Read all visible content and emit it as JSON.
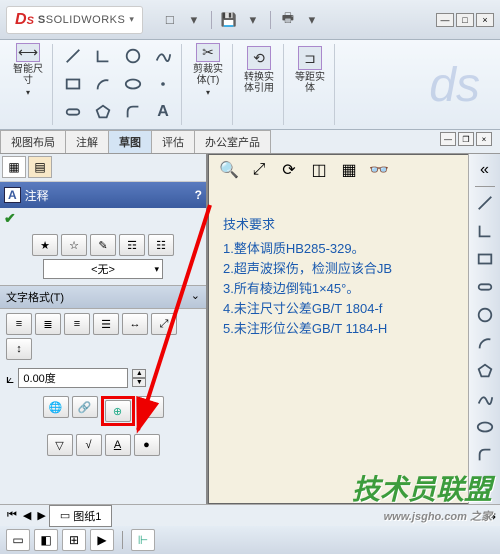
{
  "app": {
    "brand_prefix": "S",
    "brand": "SOLIDWORKS"
  },
  "ribbon": {
    "smart_dim": "智能尺\n寸",
    "trim": "剪裁实\n体(T)",
    "convert": "转换实\n体引用",
    "offset": "等距实\n体"
  },
  "tabs": [
    "视图布局",
    "注解",
    "草图",
    "评估",
    "办公室产品"
  ],
  "active_tab": 2,
  "panel": {
    "header_A": "A",
    "header_title": "注释",
    "header_help": "?",
    "style_combo": "<无>",
    "format_title": "文字格式(T)",
    "angle_value": "0.00度"
  },
  "notes_block": {
    "title": "技术要求",
    "lines": [
      "1.整体调质HB285-329。",
      "2.超声波探伤，检测应该合JB",
      "3.所有棱边倒钝1×45°。",
      "4.未注尺寸公差GB/T 1804-f",
      "5.未注形位公差GB/T 1184-H"
    ]
  },
  "sheet": {
    "icon": "▭",
    "name": "图纸1"
  },
  "watermark": {
    "main": "技术员联盟",
    "sub": "www.jsgho.com 之家"
  }
}
